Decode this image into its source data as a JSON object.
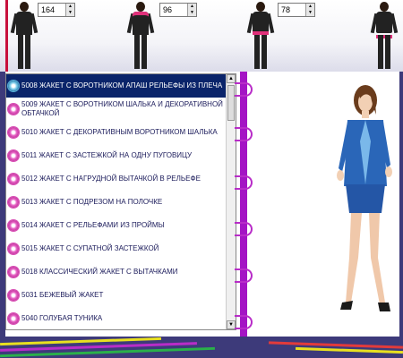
{
  "size_controls": [
    {
      "value": "164"
    },
    {
      "value": "96"
    },
    {
      "value": "78"
    }
  ],
  "list_items": [
    {
      "code": "5008",
      "label": "5008 ЖАКЕТ С ВОРОТНИКОМ АПАШ РЕЛЬЕФЫ ИЗ ПЛЕЧА",
      "selected": true
    },
    {
      "code": "5009",
      "label": "5009 ЖАКЕТ С ВОРОТНИКОМ ШАЛЬКА И ДЕКОРАТИВНОЙ ОБТАЧКОЙ",
      "selected": false
    },
    {
      "code": "5010",
      "label": "5010 ЖАКЕТ С ДЕКОРАТИВНЫМ ВОРОТНИКОМ ШАЛЬКА",
      "selected": false
    },
    {
      "code": "5011",
      "label": "5011 ЖАКЕТ С ЗАСТЕЖКОЙ НА ОДНУ ПУГОВИЦУ",
      "selected": false
    },
    {
      "code": "5012",
      "label": "5012 ЖАКЕТ С НАГРУДНОЙ ВЫТАЧКОЙ В РЕЛЬЕФЕ",
      "selected": false
    },
    {
      "code": "5013",
      "label": "5013 ЖАКЕТ С ПОДРЕЗОМ НА ПОЛОЧКЕ",
      "selected": false
    },
    {
      "code": "5014",
      "label": "5014 ЖАКЕТ С РЕЛЬЕФАМИ ИЗ ПРОЙМЫ",
      "selected": false
    },
    {
      "code": "5015",
      "label": "5015 ЖАКЕТ С СУПАТНОЙ ЗАСТЕЖКОЙ",
      "selected": false
    },
    {
      "code": "5018",
      "label": "5018 КЛАССИЧЕСКИЙ ЖАКЕТ С ВЫТАЧКАМИ",
      "selected": false
    },
    {
      "code": "5031",
      "label": "5031 БЕЖЕВЫЙ ЖАКЕТ",
      "selected": false
    },
    {
      "code": "5040",
      "label": "5040 ГОЛУБАЯ ТУНИКА",
      "selected": false
    }
  ],
  "colors": {
    "selection": "#0a246a",
    "spine": "#a414c4",
    "background": "#3d3a7a",
    "accent_red": "#c8103c"
  },
  "icons": {
    "list_item": "flower-icon",
    "spinner_up": "arrow-up-icon",
    "spinner_down": "arrow-down-icon"
  }
}
